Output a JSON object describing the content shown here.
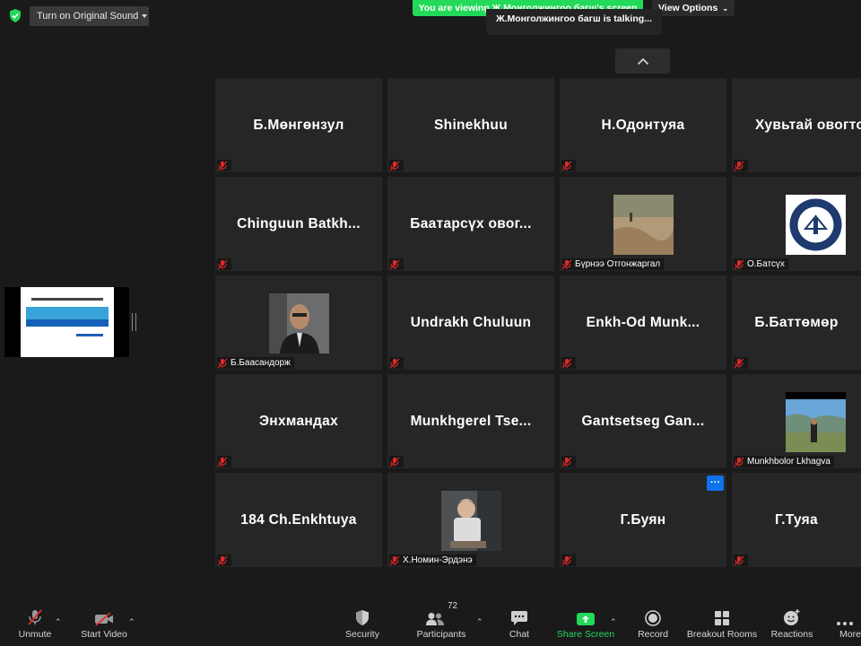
{
  "top": {
    "original_sound_label": "Turn on Original Sound",
    "viewing_banner": "You are viewing Ж.Монголжингоо багш's screen",
    "view_options": "View Options",
    "talking": "Ж.Монголжингоо багш is talking...",
    "colors": {
      "banner": "#23d959",
      "security_shield": "#23d959"
    }
  },
  "tiles": [
    {
      "name": "Б.Мөнгөнзул",
      "caption": ""
    },
    {
      "name": "Shinekhuu",
      "caption": ""
    },
    {
      "name": "Н.Одонтуяа",
      "caption": ""
    },
    {
      "name": "Хувьтай овогто",
      "caption": ""
    },
    {
      "name": "Chinguun  Batkh...",
      "caption": ""
    },
    {
      "name": "Баатарсүх овог...",
      "caption": ""
    },
    {
      "name": "",
      "caption": "Бүрнээ Отгонжаргал",
      "photo": "outdoor-photo"
    },
    {
      "name": "",
      "caption": "О.Батсүх",
      "photo": "emblem-photo"
    },
    {
      "name": "",
      "caption": "Б.Баасандорж",
      "photo": "person-photo"
    },
    {
      "name": "Undrakh Chuluun",
      "caption": ""
    },
    {
      "name": "Enkh-Od  Munk...",
      "caption": ""
    },
    {
      "name": "Б.Баттөмөр",
      "caption": ""
    },
    {
      "name": "Энхмандах",
      "caption": ""
    },
    {
      "name": "Munkhgerel  Tse...",
      "caption": ""
    },
    {
      "name": "Gantsetseg  Gan...",
      "caption": ""
    },
    {
      "name": "",
      "caption": "Munkhbolor Lkhagva",
      "photo": "landscape-photo"
    },
    {
      "name": "184 Ch.Enkhtuya",
      "caption": ""
    },
    {
      "name": "",
      "caption": "Х.Номин-Эрдэнэ",
      "photo": "child-photo"
    },
    {
      "name": "Г.Буян",
      "caption": ""
    },
    {
      "name": "Г.Туяа",
      "caption": ""
    }
  ],
  "more_button": "···",
  "toolbar": {
    "unmute": "Unmute",
    "start_video": "Start Video",
    "security": "Security",
    "participants": "Participants",
    "participants_count": "72",
    "chat": "Chat",
    "share_screen": "Share Screen",
    "record": "Record",
    "breakout_rooms": "Breakout Rooms",
    "reactions": "Reactions",
    "more": "More",
    "colors": {
      "share": "#23d959",
      "muted": "#e02828"
    }
  }
}
